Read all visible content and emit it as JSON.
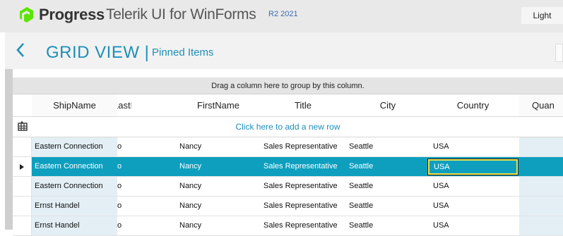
{
  "app": {
    "brand": "Progress",
    "product": "Telerik UI for WinForms",
    "version": "R2 2021",
    "theme_button": "Light",
    "accent": "#1e8fb8",
    "selection_color": "#0e9fbf"
  },
  "page": {
    "back_icon": "chevron-left-icon",
    "title": "GRID VIEW |",
    "subtitle": "Pinned Items"
  },
  "grid": {
    "group_panel": "Drag a column here to group by this column.",
    "new_row_text": "Click here to add a new row",
    "columns": [
      "ShipName",
      "LastName",
      "FirstName",
      "Title",
      "City",
      "Country",
      "Quan"
    ],
    "rows": [
      {
        "ShipName": "Eastern Connection",
        "LastName": "o",
        "FirstName": "Nancy",
        "Title": "Sales Representative",
        "City": "Seattle",
        "Country": "USA",
        "selected": false
      },
      {
        "ShipName": "Eastern Connection",
        "LastName": "o",
        "FirstName": "Nancy",
        "Title": "Sales Representative",
        "City": "Seattle",
        "Country": "USA",
        "selected": true
      },
      {
        "ShipName": "Eastern Connection",
        "LastName": "o",
        "FirstName": "Nancy",
        "Title": "Sales Representative",
        "City": "Seattle",
        "Country": "USA",
        "selected": false
      },
      {
        "ShipName": "Ernst Handel",
        "LastName": "o",
        "FirstName": "Nancy",
        "Title": "Sales Representative",
        "City": "Seattle",
        "Country": "USA",
        "selected": false
      },
      {
        "ShipName": "Ernst Handel",
        "LastName": "o",
        "FirstName": "Nancy",
        "Title": "Sales Representative",
        "City": "Seattle",
        "Country": "USA",
        "selected": false
      }
    ]
  }
}
